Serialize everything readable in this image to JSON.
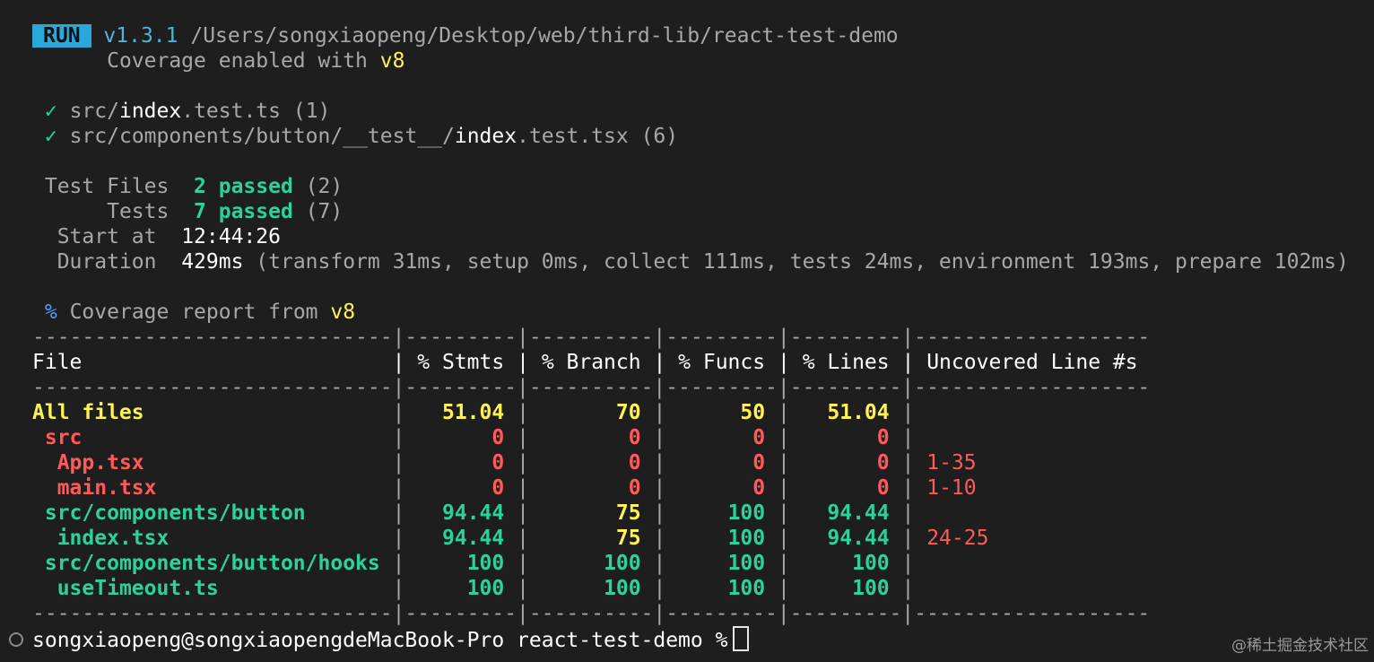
{
  "header": {
    "badge": "RUN",
    "version": "v1.3.1",
    "path": "/Users/songxiaopeng/Desktop/web/third-lib/react-test-demo",
    "coverage_prefix": "Coverage enabled with",
    "coverage_provider": "v8"
  },
  "test_files": [
    {
      "check": "✓",
      "dir": "src/",
      "name": "index",
      "ext": ".test.ts",
      "count": "(1)"
    },
    {
      "check": "✓",
      "dir": "src/components/button/__test__/",
      "name": "index",
      "ext": ".test.tsx",
      "count": "(6)"
    }
  ],
  "summary": {
    "test_files_label": "Test Files",
    "test_files_passed": "2 passed",
    "test_files_total": "(2)",
    "tests_label": "Tests",
    "tests_passed": "7 passed",
    "tests_total": "(7)",
    "start_label": "Start at",
    "start_value": "12:44:26",
    "duration_label": "Duration",
    "duration_value": "429ms",
    "duration_detail": "(transform 31ms, setup 0ms, collect 111ms, tests 24ms, environment 193ms, prepare 102ms)"
  },
  "coverage": {
    "percent_icon": "%",
    "title_prefix": "Coverage report from",
    "provider": "v8",
    "separator": "-----------------------------|---------|----------|---------|---------|-------------------",
    "headers": [
      "File",
      "% Stmts",
      "% Branch",
      "% Funcs",
      "% Lines",
      "Uncovered Line #s"
    ],
    "rows": [
      {
        "file": "All files",
        "indent": 0,
        "stmts": "51.04",
        "branch": "70",
        "funcs": "50",
        "lines": "51.04",
        "uncovered": ""
      },
      {
        "file": "src",
        "indent": 1,
        "stmts": "0",
        "branch": "0",
        "funcs": "0",
        "lines": "0",
        "uncovered": ""
      },
      {
        "file": "App.tsx",
        "indent": 2,
        "stmts": "0",
        "branch": "0",
        "funcs": "0",
        "lines": "0",
        "uncovered": "1-35"
      },
      {
        "file": "main.tsx",
        "indent": 2,
        "stmts": "0",
        "branch": "0",
        "funcs": "0",
        "lines": "0",
        "uncovered": "1-10"
      },
      {
        "file": "src/components/button",
        "indent": 1,
        "stmts": "94.44",
        "branch": "75",
        "funcs": "100",
        "lines": "94.44",
        "uncovered": ""
      },
      {
        "file": "index.tsx",
        "indent": 2,
        "stmts": "94.44",
        "branch": "75",
        "funcs": "100",
        "lines": "94.44",
        "uncovered": "24-25"
      },
      {
        "file": "src/components/button/hooks",
        "indent": 1,
        "stmts": "100",
        "branch": "100",
        "funcs": "100",
        "lines": "100",
        "uncovered": ""
      },
      {
        "file": "useTimeout.ts",
        "indent": 2,
        "stmts": "100",
        "branch": "100",
        "funcs": "100",
        "lines": "100",
        "uncovered": ""
      }
    ],
    "value_colors": {
      "51.04": "yellow",
      "70": "yellow",
      "50": "yellow",
      "0": "red",
      "75": "yellow",
      "94.44": "green",
      "100": "green"
    },
    "file_colors": [
      "yellow",
      "red",
      "red",
      "red",
      "green",
      "green",
      "green",
      "green"
    ]
  },
  "prompt": {
    "text": "songxiaopeng@songxiaopengdeMacBook-Pro react-test-demo %"
  },
  "watermark": "@稀土掘金技术社区",
  "colors": {
    "background": "#1e1e1e",
    "badge": "#29a8d9",
    "green": "#2ed199",
    "yellow": "#fff257",
    "red": "#ff5a5a",
    "cyan": "#4fb6d8"
  }
}
